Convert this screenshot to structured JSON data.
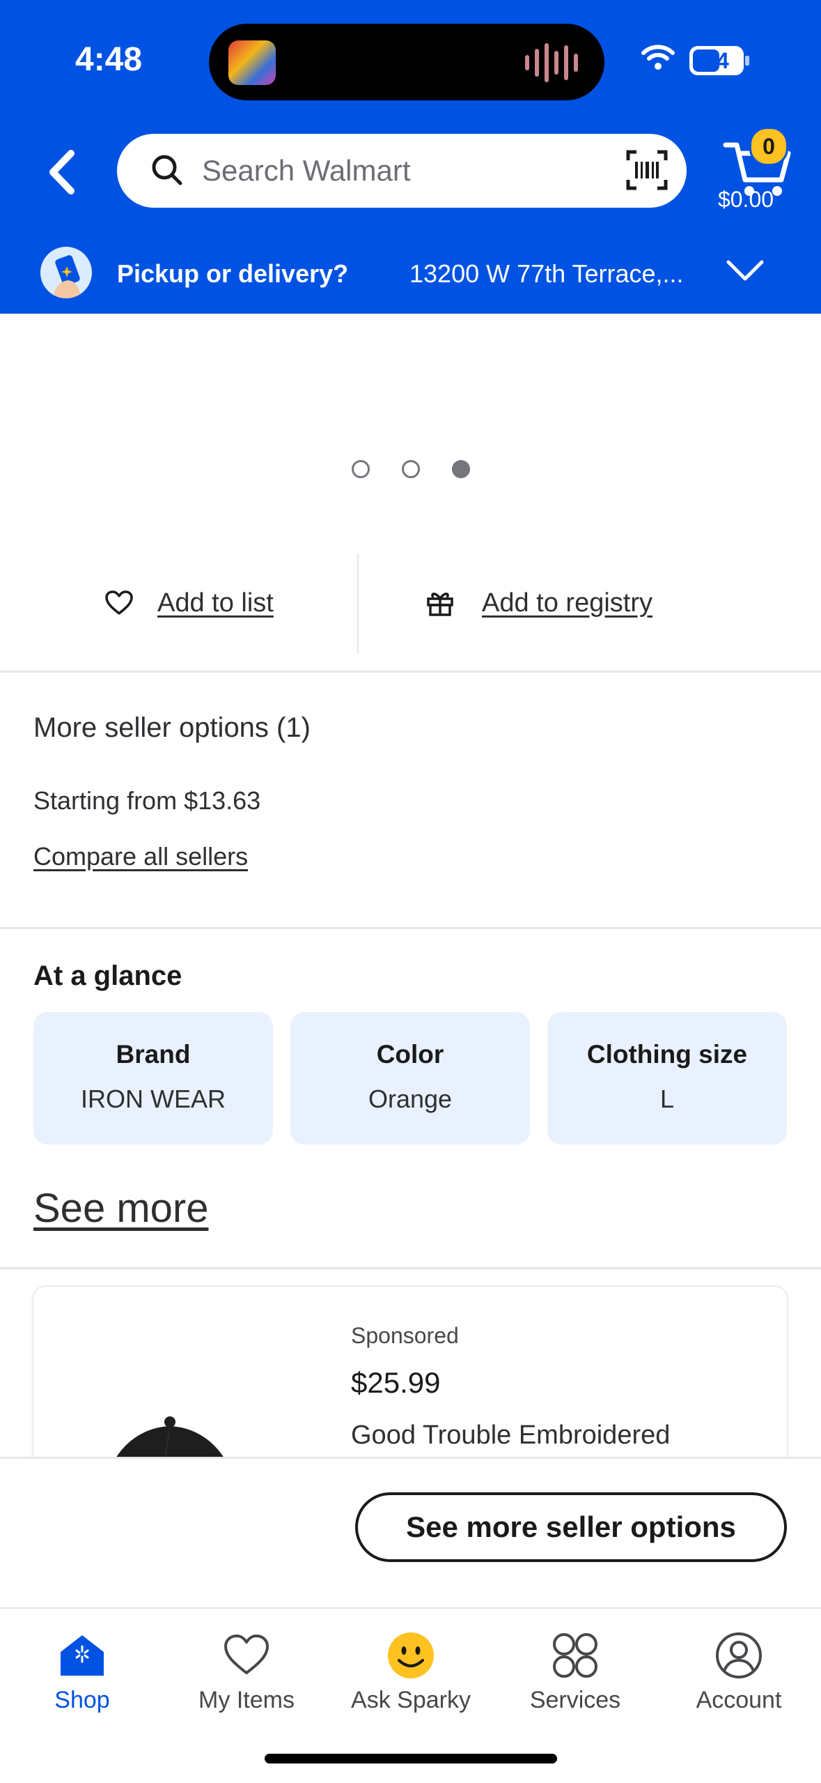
{
  "status_bar": {
    "time": "4:48",
    "battery": "34"
  },
  "header": {
    "search_placeholder": "Search Walmart",
    "cart_count": "0",
    "cart_total": "$0.00",
    "pickup_label": "Pickup or delivery?",
    "pickup_address": "13200 W 77th Terrace,..."
  },
  "carousel": {
    "total": 3,
    "active_index": 2
  },
  "actions": {
    "add_to_list": "Add to list",
    "add_to_registry": "Add to registry"
  },
  "seller_options": {
    "title": "More seller options (1)",
    "starting_from": "Starting from $13.63",
    "compare_link": "Compare all sellers"
  },
  "at_a_glance": {
    "title": "At a glance",
    "cards": [
      {
        "label": "Brand",
        "value": "IRON WEAR"
      },
      {
        "label": "Color",
        "value": "Orange"
      },
      {
        "label": "Clothing size",
        "value": "L"
      }
    ],
    "see_more": "See more"
  },
  "sponsored_item": {
    "label": "Sponsored",
    "price": "$25.99",
    "name": "Good Trouble Embroidered"
  },
  "sticky_button": "See more seller options",
  "tabbar": {
    "tabs": [
      {
        "label": "Shop",
        "icon": "walmart-home-icon",
        "active": true
      },
      {
        "label": "My Items",
        "icon": "heart-icon",
        "active": false
      },
      {
        "label": "Ask Sparky",
        "icon": "sparky-smiley-icon",
        "active": false
      },
      {
        "label": "Services",
        "icon": "grid-circles-icon",
        "active": false
      },
      {
        "label": "Account",
        "icon": "person-icon",
        "active": false
      }
    ]
  },
  "colors": {
    "brand_blue": "#0053e2",
    "spark_yellow": "#ffc220",
    "card_blue": "#e9f1fe"
  }
}
